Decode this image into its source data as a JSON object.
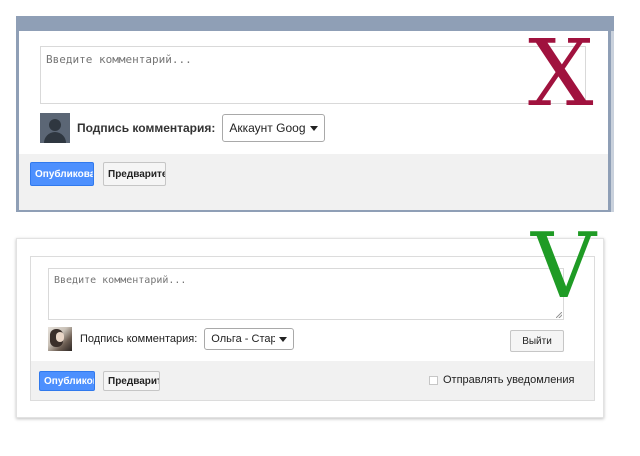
{
  "top_example": {
    "comment_placeholder": "Введите комментарий...",
    "signature_label": "Подпись комментария:",
    "signature_value": "Аккаунт Googl",
    "publish_button": "Опубликова",
    "preview_button": "Предварите",
    "mark": "X",
    "mark_color": "#a0123e"
  },
  "bottom_example": {
    "comment_placeholder": "Введите комментарий...",
    "signature_label": "Подпись комментария:",
    "signature_value": "Ольга - Стара",
    "logout_button": "Выйти",
    "publish_button": "Опубликова",
    "preview_button": "Предварите",
    "notify_label": "Отправлять уведомления",
    "notify_checked": false,
    "mark": "V",
    "mark_color": "#1f9b25"
  },
  "colors": {
    "primary_button": "#4d90fe",
    "frame_top_border": "#8f9fb6",
    "footer_bg": "#f1f1f1"
  },
  "icons": {
    "top_avatar": "default-user-avatar-icon",
    "bottom_avatar": "user-photo-avatar",
    "select_chevron": "chevron-down-icon",
    "resize_grip": "resize-grip-icon"
  }
}
